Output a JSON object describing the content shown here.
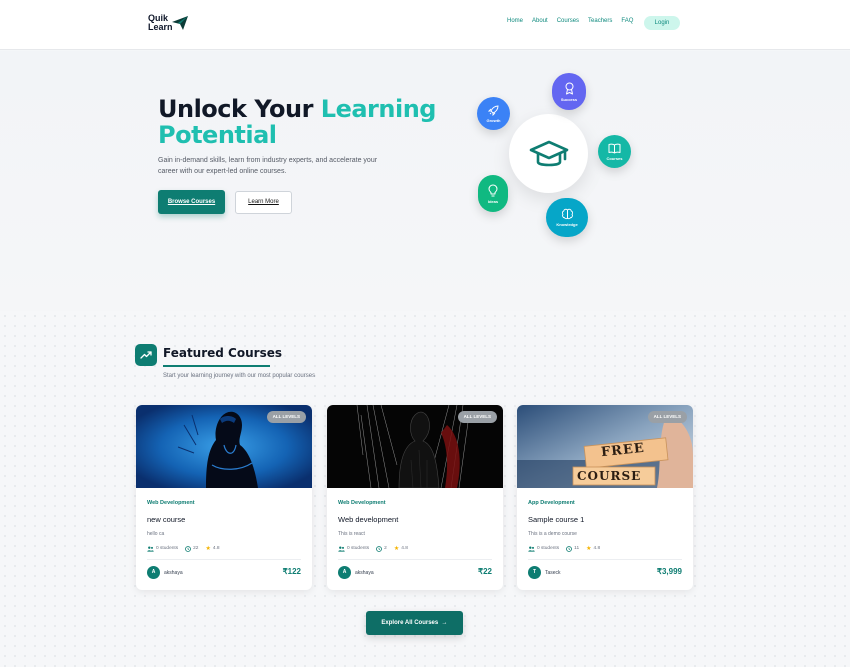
{
  "nav": {
    "logo_line1": "Quik",
    "logo_line2": "Learn",
    "links": [
      "Home",
      "About",
      "Courses",
      "Teachers",
      "FAQ"
    ],
    "login_label": "Login"
  },
  "hero": {
    "title_plain": "Unlock Your ",
    "title_accent_1": "Learning",
    "title_accent_2": "Potential",
    "description": "Gain in-demand skills, learn from industry experts, and accelerate your career with our expert-led online courses.",
    "browse_label": "Browse Courses",
    "learn_label": "Learn More",
    "bubbles": [
      "Growth",
      "Success",
      "Courses",
      "Ideas",
      "Knowledge"
    ]
  },
  "featured": {
    "title": "Featured Courses",
    "subtitle": "Start your learning journey with our most popular courses",
    "explore_label": "Explore All Courses",
    "cards": [
      {
        "badge": "ALL LEVELS",
        "category": "Web Development",
        "title": "new course",
        "description": "hello ca",
        "students": "0 students",
        "lessons": "22",
        "rating": "4.8",
        "instructor_initial": "A",
        "instructor": "akshaya",
        "price": "₹122"
      },
      {
        "badge": "ALL LEVELS",
        "category": "Web Development",
        "title": "Web development",
        "description": "This is react",
        "students": "0 students",
        "lessons": "2",
        "rating": "4.8",
        "instructor_initial": "A",
        "instructor": "akshaya",
        "price": "₹22"
      },
      {
        "badge": "ALL LEVELS",
        "category": "App Development",
        "title": "Sample course 1",
        "description": "This is a demo course",
        "students": "0 students",
        "lessons": "11",
        "rating": "4.8",
        "instructor_initial": "T",
        "instructor": "Taseck",
        "price": "₹3,999",
        "image_text_1": "FREE",
        "image_text_2": "COURSE"
      }
    ]
  },
  "colors": {
    "primary": "#0e7d72",
    "accent": "#1fbfb0",
    "growth": "#3b82f6",
    "success": "#6366f1",
    "courses": "#14b8a6",
    "ideas": "#10b981",
    "knowledge": "#06a6c8"
  }
}
